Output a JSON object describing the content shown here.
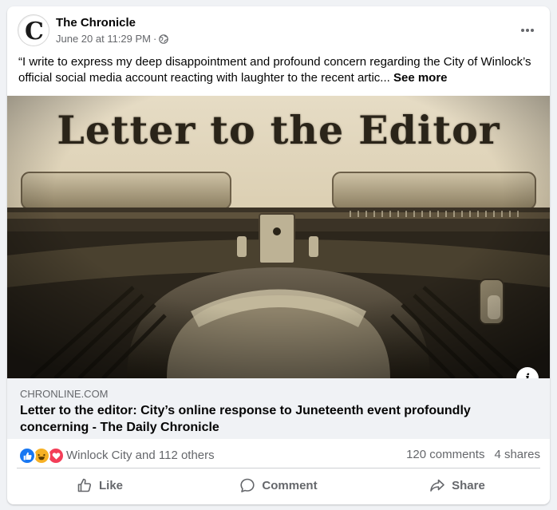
{
  "post": {
    "page_name": "The Chronicle",
    "avatar_letter": "C",
    "timestamp": "June 20 at 11:29 PM",
    "separator": "·",
    "privacy_icon": "globe-icon",
    "more_icon": "more-options-icon",
    "text": "“I write to express my deep disappointment and profound concern regarding the City of Winlock’s official social media account reacting with laughter to the recent artic...",
    "see_more_label": "See more"
  },
  "link_preview": {
    "image_text": "Letter to the Editor",
    "info_label": "i",
    "domain": "CHRONLINE.COM",
    "title": "Letter to the editor: City’s online response to Juneteenth event profoundly concerning - The Daily Chronicle"
  },
  "engagement": {
    "reaction_icons": [
      "like-reaction-icon",
      "haha-reaction-icon",
      "love-reaction-icon"
    ],
    "reactions_text": "Winlock City and 112 others",
    "comments": "120 comments",
    "shares": "4 shares"
  },
  "actions": {
    "like_label": "Like",
    "comment_label": "Comment",
    "share_label": "Share"
  },
  "colors": {
    "background": "#f0f2f5",
    "card": "#ffffff",
    "secondary_text": "#65676b",
    "like_blue": "#1877f2",
    "haha_yellow": "#f7b125",
    "love_red": "#f33e58"
  }
}
